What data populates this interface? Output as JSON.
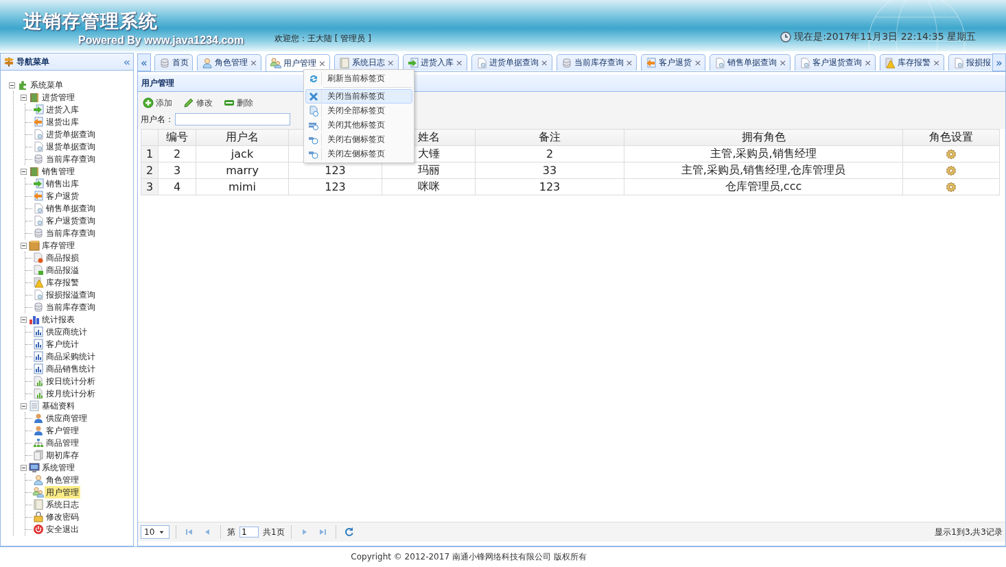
{
  "header": {
    "title": "进销存管理系统",
    "powered": "Powered By www.java1234.com",
    "welcome": "欢迎您：王大陆 [ 管理员 ]",
    "clock": "现在是:2017年11月3日 22:14:35 星期五"
  },
  "sidebar": {
    "title": "导航菜单",
    "collapse": "«",
    "tree": [
      {
        "label": "系统菜单",
        "kind": "puzzle",
        "expanded": true,
        "selected": false,
        "children": [
          {
            "label": "进货管理",
            "kind": "door",
            "expanded": true,
            "selected": false,
            "children": [
              {
                "label": "进货入库",
                "kind": "in",
                "selected": false
              },
              {
                "label": "退货出库",
                "kind": "out",
                "selected": false
              },
              {
                "label": "进货单据查询",
                "kind": "doc",
                "selected": false
              },
              {
                "label": "退货单据查询",
                "kind": "doc",
                "selected": false
              },
              {
                "label": "当前库存查询",
                "kind": "db",
                "selected": false
              }
            ]
          },
          {
            "label": "销售管理",
            "kind": "door",
            "expanded": true,
            "selected": false,
            "children": [
              {
                "label": "销售出库",
                "kind": "in",
                "selected": false
              },
              {
                "label": "客户退货",
                "kind": "out",
                "selected": false
              },
              {
                "label": "销售单据查询",
                "kind": "doc",
                "selected": false
              },
              {
                "label": "客户退货查询",
                "kind": "doc",
                "selected": false
              },
              {
                "label": "当前库存查询",
                "kind": "db",
                "selected": false
              }
            ]
          },
          {
            "label": "库存管理",
            "kind": "box",
            "expanded": true,
            "selected": false,
            "children": [
              {
                "label": "商品报损",
                "kind": "docminus",
                "selected": false
              },
              {
                "label": "商品报溢",
                "kind": "docplus",
                "selected": false
              },
              {
                "label": "库存报警",
                "kind": "warning",
                "selected": false
              },
              {
                "label": "报损报溢查询",
                "kind": "doc",
                "selected": false
              },
              {
                "label": "当前库存查询",
                "kind": "db",
                "selected": false
              }
            ]
          },
          {
            "label": "统计报表",
            "kind": "bars",
            "expanded": true,
            "selected": false,
            "children": [
              {
                "label": "供应商统计",
                "kind": "report",
                "selected": false
              },
              {
                "label": "客户统计",
                "kind": "report",
                "selected": false
              },
              {
                "label": "商品采购统计",
                "kind": "report",
                "selected": false
              },
              {
                "label": "商品销售统计",
                "kind": "report",
                "selected": false
              },
              {
                "label": "按日统计分析",
                "kind": "chart",
                "selected": false
              },
              {
                "label": "按月统计分析",
                "kind": "chart",
                "selected": false
              }
            ]
          },
          {
            "label": "基础资料",
            "kind": "list",
            "expanded": true,
            "selected": false,
            "children": [
              {
                "label": "供应商管理",
                "kind": "person",
                "selected": false
              },
              {
                "label": "客户管理",
                "kind": "person",
                "selected": false
              },
              {
                "label": "商品管理",
                "kind": "tree",
                "selected": false
              },
              {
                "label": "期初库存",
                "kind": "pages",
                "selected": false
              }
            ]
          },
          {
            "label": "系统管理",
            "kind": "monitor",
            "expanded": true,
            "selected": false,
            "children": [
              {
                "label": "角色管理",
                "kind": "user",
                "selected": false
              },
              {
                "label": "用户管理",
                "kind": "users",
                "selected": true
              },
              {
                "label": "系统日志",
                "kind": "log",
                "selected": false
              },
              {
                "label": "修改密码",
                "kind": "lock",
                "selected": false
              },
              {
                "label": "安全退出",
                "kind": "exit",
                "selected": false
              }
            ]
          }
        ]
      }
    ]
  },
  "tabs_scroll_left": "«",
  "tabs_scroll_right": "»",
  "tabs": [
    {
      "label": "首页",
      "kind": "db",
      "selected": false
    },
    {
      "label": "角色管理",
      "kind": "user",
      "selected": false,
      "close": "×"
    },
    {
      "label": "用户管理",
      "kind": "users",
      "selected": true,
      "close": "×"
    },
    {
      "label": "系统日志",
      "kind": "log",
      "selected": false,
      "close": "×"
    },
    {
      "label": "进货入库",
      "kind": "in",
      "selected": false,
      "close": "×"
    },
    {
      "label": "进货单据查询",
      "kind": "doc",
      "selected": false,
      "close": "×"
    },
    {
      "label": "当前库存查询",
      "kind": "db",
      "selected": false,
      "close": "×"
    },
    {
      "label": "客户退货",
      "kind": "out",
      "selected": false,
      "close": "×"
    },
    {
      "label": "销售单据查询",
      "kind": "doc",
      "selected": false,
      "close": "×"
    },
    {
      "label": "客户退货查询",
      "kind": "doc",
      "selected": false,
      "close": "×"
    },
    {
      "label": "库存报警",
      "kind": "warning",
      "selected": false,
      "close": "×"
    },
    {
      "label": "报损报",
      "kind": "doc",
      "selected": false
    }
  ],
  "panel": {
    "title": "用户管理",
    "toolbar": [
      {
        "label": "添加",
        "kind": "add"
      },
      {
        "label": "修改",
        "kind": "edit"
      },
      {
        "label": "删除",
        "kind": "delete"
      }
    ],
    "search": {
      "label": "用户名："
    },
    "table": {
      "columns": [
        {
          "label": "编号"
        },
        {
          "label": "用户名"
        },
        {},
        {
          "label": "姓名"
        },
        {
          "label": "备注"
        },
        {
          "label": "拥有角色"
        },
        {
          "label": "角色设置"
        }
      ],
      "rows": [
        {
          "index": "1",
          "cells": [
            "2",
            "jack",
            null,
            "大锤",
            "2",
            "主管,采购员,销售经理"
          ]
        },
        {
          "index": "2",
          "cells": [
            "3",
            "marry",
            "123",
            "玛丽",
            "33",
            "主管,采购员,销售经理,仓库管理员"
          ]
        },
        {
          "index": "3",
          "cells": [
            "4",
            "mimi",
            "123",
            "咪咪",
            "123",
            "仓库管理员,ccc"
          ]
        }
      ]
    },
    "pager": {
      "page_size": "10",
      "page_prefix": "第",
      "page": "1",
      "page_total": "共1页",
      "summary": "显示1到3,共3记录"
    }
  },
  "context_menu": [
    {
      "label": "刷新当前标签页",
      "kind": "refresh",
      "selected": false
    },
    {
      "label": "关闭当前标签页",
      "kind": "close",
      "selected": true
    },
    {
      "label": "关闭全部标签页",
      "kind": "closeall",
      "selected": false
    },
    {
      "label": "关闭其他标签页",
      "kind": "closeother",
      "selected": false
    },
    {
      "label": "关闭右侧标签页",
      "kind": "closeright",
      "selected": false
    },
    {
      "label": "关闭左侧标签页",
      "kind": "closeleft",
      "selected": false
    }
  ],
  "footer": "Copyright © 2012-2017 南通小锋网络科技有限公司 版权所有"
}
